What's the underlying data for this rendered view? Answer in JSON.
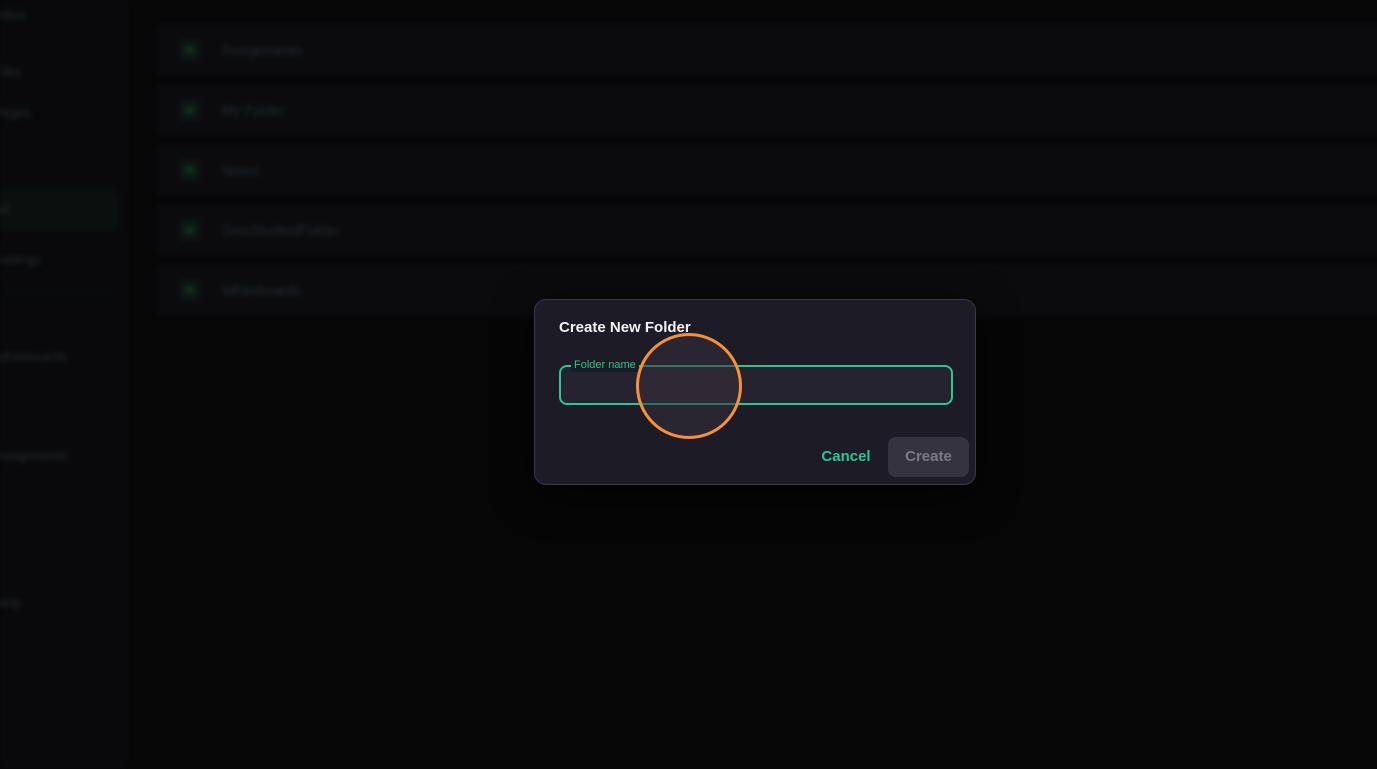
{
  "sidebar": {
    "items": [
      {
        "label": "Inbox"
      },
      {
        "label": "Files"
      },
      {
        "label": "Pages"
      },
      {
        "label": "All"
      },
      {
        "label": "Settings"
      },
      {
        "label": "Whiteboards"
      },
      {
        "label": "Assignments"
      },
      {
        "label": "Help"
      }
    ]
  },
  "folders": [
    {
      "name": "Assignments"
    },
    {
      "name": "My Folder"
    },
    {
      "name": "Notes"
    },
    {
      "name": "SamStudentFolder"
    },
    {
      "name": "Whiteboards"
    }
  ],
  "dialog": {
    "title": "Create New Folder",
    "field_label": "Folder name",
    "field_value": "",
    "cancel_label": "Cancel",
    "create_label": "Create"
  },
  "colors": {
    "accent": "#2ec592",
    "dialog_bg": "#1c1b26",
    "click_ring": "#f5913e",
    "page_bg": "#0a0a0c"
  }
}
